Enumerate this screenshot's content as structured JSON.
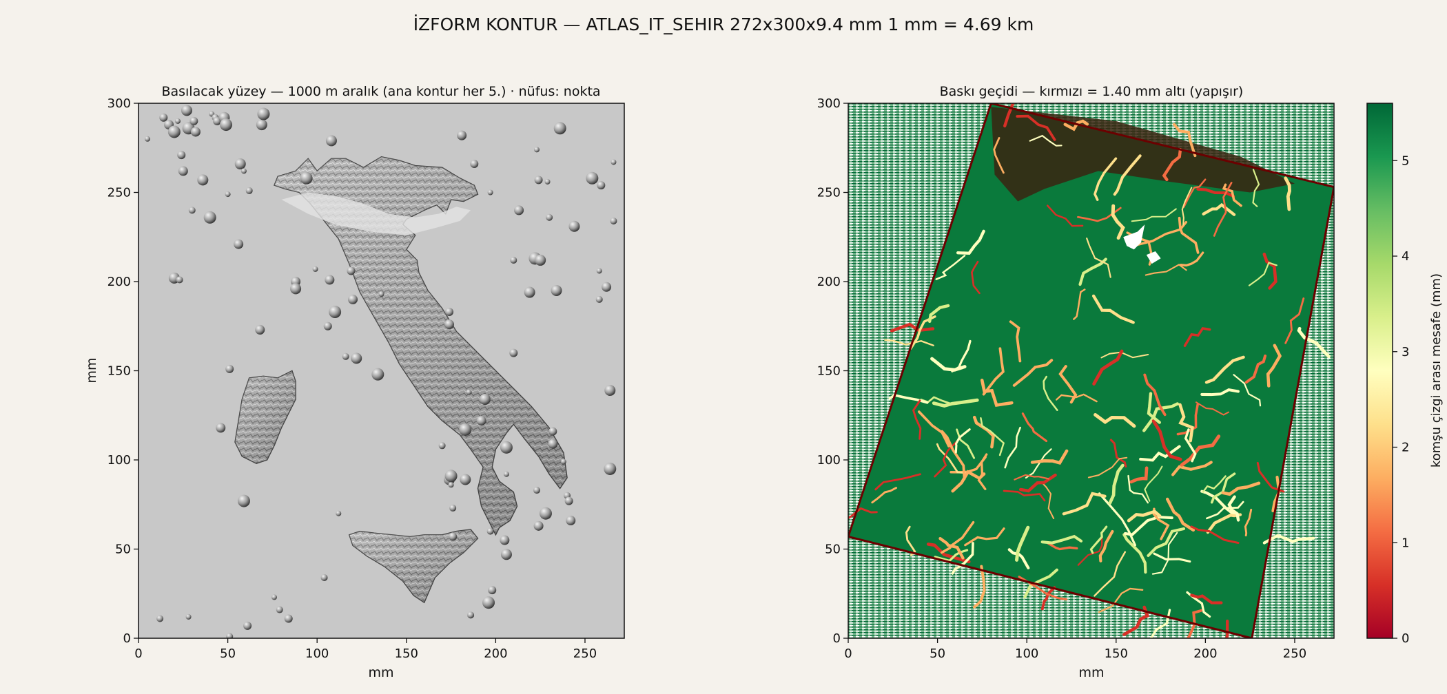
{
  "figure": {
    "suptitle": "İZFORM KONTUR — ATLAS_IT_SEHIR   272x300x9.4 mm   1 mm = 4.69 km"
  },
  "chart_data": [
    {
      "type": "heatmap",
      "title": "Basılacak yüzey — 1000 m aralık (ana kontur her 5.)   ·   nüfus: nokta",
      "xlabel": "mm",
      "ylabel": "mm",
      "xlim": [
        0,
        272
      ],
      "ylim": [
        0,
        300
      ],
      "xticks": [
        0,
        50,
        100,
        150,
        200,
        250
      ],
      "yticks": [
        0,
        50,
        100,
        150,
        200,
        250,
        300
      ],
      "grid": false,
      "colors": {
        "background": "#c8c8c8",
        "shade": "#8a8a8a"
      },
      "relief_outline": [
        [
          78,
          259
        ],
        [
          88,
          262
        ],
        [
          95,
          269
        ],
        [
          100,
          262
        ],
        [
          108,
          269
        ],
        [
          116,
          269
        ],
        [
          126,
          264
        ],
        [
          136,
          270
        ],
        [
          146,
          268
        ],
        [
          155,
          265
        ],
        [
          170,
          264
        ],
        [
          180,
          258
        ],
        [
          188,
          254
        ],
        [
          190,
          249
        ],
        [
          182,
          245
        ],
        [
          175,
          246
        ],
        [
          172,
          238
        ],
        [
          167,
          243
        ],
        [
          160,
          240
        ],
        [
          150,
          235
        ],
        [
          148,
          232
        ],
        [
          155,
          226
        ],
        [
          150,
          218
        ],
        [
          156,
          212
        ],
        [
          157,
          205
        ],
        [
          162,
          195
        ],
        [
          170,
          185
        ],
        [
          178,
          172
        ],
        [
          190,
          160
        ],
        [
          200,
          150
        ],
        [
          210,
          140
        ],
        [
          220,
          130
        ],
        [
          230,
          118
        ],
        [
          238,
          104
        ],
        [
          240,
          90
        ],
        [
          236,
          84
        ],
        [
          230,
          92
        ],
        [
          224,
          102
        ],
        [
          216,
          112
        ],
        [
          210,
          120
        ],
        [
          206,
          115
        ],
        [
          200,
          106
        ],
        [
          198,
          96
        ],
        [
          202,
          88
        ],
        [
          210,
          82
        ],
        [
          212,
          74
        ],
        [
          208,
          66
        ],
        [
          202,
          62
        ],
        [
          200,
          58
        ],
        [
          196,
          66
        ],
        [
          192,
          74
        ],
        [
          190,
          84
        ],
        [
          193,
          96
        ],
        [
          186,
          106
        ],
        [
          180,
          114
        ],
        [
          170,
          122
        ],
        [
          162,
          130
        ],
        [
          154,
          142
        ],
        [
          146,
          154
        ],
        [
          140,
          166
        ],
        [
          132,
          180
        ],
        [
          124,
          194
        ],
        [
          118,
          210
        ],
        [
          112,
          224
        ],
        [
          104,
          234
        ],
        [
          96,
          244
        ],
        [
          90,
          250
        ],
        [
          82,
          252
        ],
        [
          76,
          254
        ]
      ],
      "sicily_outline": [
        [
          118,
          58
        ],
        [
          124,
          60
        ],
        [
          132,
          59
        ],
        [
          142,
          58
        ],
        [
          152,
          57
        ],
        [
          160,
          58
        ],
        [
          170,
          58
        ],
        [
          178,
          60
        ],
        [
          186,
          61
        ],
        [
          190,
          56
        ],
        [
          182,
          48
        ],
        [
          174,
          42
        ],
        [
          166,
          34
        ],
        [
          160,
          20
        ],
        [
          154,
          24
        ],
        [
          148,
          32
        ],
        [
          138,
          40
        ],
        [
          128,
          46
        ],
        [
          120,
          52
        ]
      ],
      "sardinia_outline": [
        [
          62,
          146
        ],
        [
          70,
          147
        ],
        [
          78,
          146
        ],
        [
          86,
          150
        ],
        [
          88,
          144
        ],
        [
          88,
          134
        ],
        [
          84,
          126
        ],
        [
          80,
          118
        ],
        [
          76,
          108
        ],
        [
          72,
          100
        ],
        [
          66,
          98
        ],
        [
          58,
          102
        ],
        [
          54,
          110
        ],
        [
          56,
          122
        ],
        [
          58,
          134
        ],
        [
          60,
          140
        ]
      ],
      "lake_outline": [
        [
          80,
          246
        ],
        [
          95,
          250
        ],
        [
          110,
          248
        ],
        [
          125,
          244
        ],
        [
          140,
          238
        ],
        [
          155,
          236
        ],
        [
          168,
          238
        ],
        [
          178,
          242
        ],
        [
          186,
          240
        ],
        [
          180,
          234
        ],
        [
          166,
          230
        ],
        [
          150,
          226
        ],
        [
          130,
          228
        ],
        [
          110,
          232
        ],
        [
          95,
          238
        ]
      ],
      "population_points": [
        [
          5,
          280
        ],
        [
          12,
          11
        ],
        [
          14,
          292
        ],
        [
          17,
          288
        ],
        [
          20,
          202
        ],
        [
          20,
          284
        ],
        [
          22,
          290
        ],
        [
          23,
          201
        ],
        [
          24,
          271
        ],
        [
          25,
          262
        ],
        [
          27,
          296
        ],
        [
          28,
          286
        ],
        [
          28,
          12
        ],
        [
          30,
          240
        ],
        [
          31,
          290
        ],
        [
          32,
          284
        ],
        [
          36,
          257
        ],
        [
          40,
          236
        ],
        [
          41,
          294
        ],
        [
          43,
          292
        ],
        [
          44,
          290
        ],
        [
          46,
          118
        ],
        [
          48,
          292
        ],
        [
          49,
          288
        ],
        [
          50,
          249
        ],
        [
          51,
          1
        ],
        [
          51,
          151
        ],
        [
          56,
          221
        ],
        [
          57,
          266
        ],
        [
          59,
          77
        ],
        [
          59,
          262
        ],
        [
          62,
          251
        ],
        [
          61,
          7
        ],
        [
          68,
          173
        ],
        [
          69,
          288
        ],
        [
          70,
          294
        ],
        [
          76,
          23
        ],
        [
          79,
          16
        ],
        [
          84,
          11
        ],
        [
          88,
          200
        ],
        [
          88,
          196
        ],
        [
          94,
          258
        ],
        [
          99,
          207
        ],
        [
          104,
          34
        ],
        [
          106,
          175
        ],
        [
          107,
          201
        ],
        [
          108,
          279
        ],
        [
          110,
          183
        ],
        [
          112,
          70
        ],
        [
          116,
          158
        ],
        [
          119,
          206
        ],
        [
          120,
          190
        ],
        [
          122,
          157
        ],
        [
          134,
          148
        ],
        [
          136,
          193
        ],
        [
          170,
          108
        ],
        [
          174,
          183
        ],
        [
          174,
          176
        ],
        [
          174,
          89
        ],
        [
          175,
          91
        ],
        [
          175,
          86
        ],
        [
          176,
          73
        ],
        [
          176,
          57
        ],
        [
          181,
          282
        ],
        [
          183,
          89
        ],
        [
          183,
          117
        ],
        [
          185,
          138
        ],
        [
          186,
          13
        ],
        [
          188,
          266
        ],
        [
          192,
          122
        ],
        [
          194,
          134
        ],
        [
          196,
          20
        ],
        [
          197,
          250
        ],
        [
          197,
          60
        ],
        [
          198,
          27
        ],
        [
          205,
          55
        ],
        [
          206,
          47
        ],
        [
          206,
          107
        ],
        [
          206,
          92
        ],
        [
          210,
          212
        ],
        [
          210,
          160
        ],
        [
          213,
          240
        ],
        [
          219,
          194
        ],
        [
          222,
          213
        ],
        [
          223,
          274
        ],
        [
          223,
          83
        ],
        [
          224,
          257
        ],
        [
          224,
          63
        ],
        [
          225,
          212
        ],
        [
          228,
          70
        ],
        [
          229,
          256
        ],
        [
          230,
          236
        ],
        [
          232,
          116
        ],
        [
          232,
          109
        ],
        [
          234,
          195
        ],
        [
          236,
          286
        ],
        [
          238,
          99
        ],
        [
          240,
          80
        ],
        [
          241,
          77
        ],
        [
          242,
          66
        ],
        [
          244,
          231
        ],
        [
          254,
          258
        ],
        [
          258,
          206
        ],
        [
          258,
          190
        ],
        [
          259,
          254
        ],
        [
          262,
          197
        ],
        [
          264,
          139
        ],
        [
          264,
          95
        ],
        [
          266,
          267
        ],
        [
          266,
          234
        ]
      ]
    },
    {
      "type": "heatmap",
      "title": "Baskı geçidi — kırmızı = 1.40 mm altı (yapışır)",
      "xlabel": "mm",
      "ylabel": "",
      "xlim": [
        0,
        272
      ],
      "ylim": [
        0,
        300
      ],
      "xticks": [
        0,
        50,
        100,
        150,
        200,
        250
      ],
      "yticks": [
        0,
        50,
        100,
        150,
        200,
        250,
        300
      ],
      "grid": false,
      "colorbar": {
        "label": "komşu çizgi arası mesafe (mm)",
        "range": [
          0,
          5.6
        ],
        "ticks": [
          0,
          1,
          2,
          3,
          4,
          5
        ],
        "stops": [
          "#a50026",
          "#d73027",
          "#f46d43",
          "#fdae61",
          "#fee08b",
          "#ffffbf",
          "#d9ef8b",
          "#a6d96a",
          "#66bd63",
          "#1a9850",
          "#006837"
        ]
      },
      "frame_outline": [
        [
          80,
          300
        ],
        [
          272,
          253
        ],
        [
          226,
          0
        ],
        [
          0,
          57
        ]
      ],
      "dense_band_outline": [
        [
          80,
          298
        ],
        [
          150,
          290
        ],
        [
          220,
          270
        ],
        [
          250,
          255
        ],
        [
          225,
          250
        ],
        [
          180,
          256
        ],
        [
          140,
          262
        ],
        [
          110,
          252
        ],
        [
          95,
          245
        ],
        [
          82,
          260
        ]
      ],
      "white_gaps": [
        [
          [
            154,
            225
          ],
          [
            162,
            228
          ],
          [
            166,
            232
          ],
          [
            164,
            222
          ],
          [
            160,
            218
          ],
          [
            156,
            220
          ]
        ],
        [
          [
            167,
            215
          ],
          [
            172,
            217
          ],
          [
            175,
            213
          ],
          [
            170,
            210
          ]
        ]
      ],
      "red_threshold_mm": 1.4
    }
  ]
}
